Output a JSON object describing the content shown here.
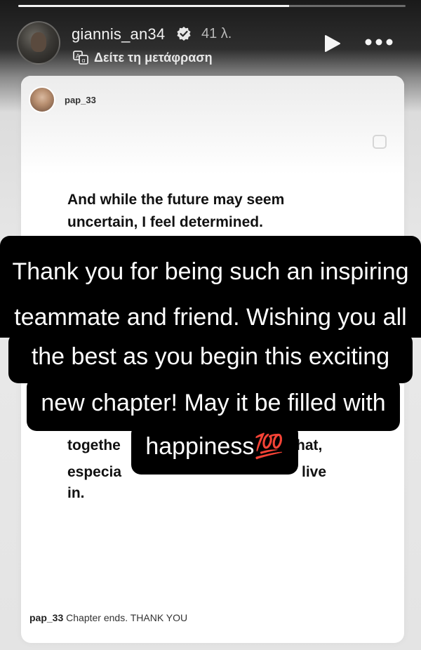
{
  "story": {
    "progress": 0.7,
    "username": "giannis_an34",
    "timestamp": "41 λ.",
    "translate_label": "Δείτε τη μετάφραση"
  },
  "post": {
    "author": "pap_33",
    "text_lines_top": [
      "And while the future may seem",
      "uncertain, I feel determined."
    ],
    "text_lines_bottom": [
      "togethe",
      "hat,",
      "especia",
      "live",
      "in."
    ],
    "caption_author": "pap_33",
    "caption_text": "Chapter ends. THANK YOU"
  },
  "overlay": {
    "lines": [
      "Thank you for being such an inspiring",
      "teammate and friend. Wishing you all",
      "the best as you begin this exciting",
      "new chapter! May it be filled with",
      "happiness💯"
    ]
  },
  "colors": {
    "overlay_bg": "#000000",
    "overlay_text": "#ffffff"
  },
  "icons": [
    "verified-icon",
    "translate-icon",
    "play-icon",
    "more-icon",
    "square-icon"
  ]
}
